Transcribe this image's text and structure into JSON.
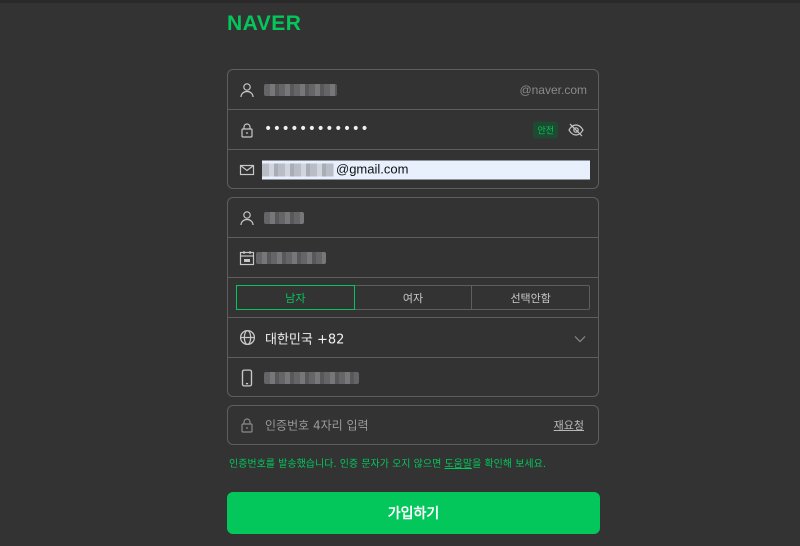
{
  "brand": {
    "logo": "NAVER",
    "color": "#03c75a"
  },
  "account": {
    "id_suffix": "@naver.com",
    "password_mask": "••••••••••••",
    "password_strength": "안전",
    "email_suffix": "@gmail.com"
  },
  "profile": {
    "gender_options": [
      "남자",
      "여자",
      "선택안함"
    ],
    "gender_selected": "남자",
    "country": "대한민국 +82"
  },
  "verification": {
    "placeholder": "인증번호 4자리 입력",
    "resend_label": "재요청",
    "notice_before": "인증번호를 발송했습니다. 인증 문자가 오지 않으면 ",
    "notice_link": "도움말",
    "notice_after": "을 확인해 보세요."
  },
  "submit_label": "가입하기",
  "icons": [
    "user-icon",
    "lock-icon",
    "eye-off-icon",
    "mail-icon",
    "calendar-icon",
    "globe-icon",
    "chevron-down-icon",
    "phone-icon"
  ]
}
